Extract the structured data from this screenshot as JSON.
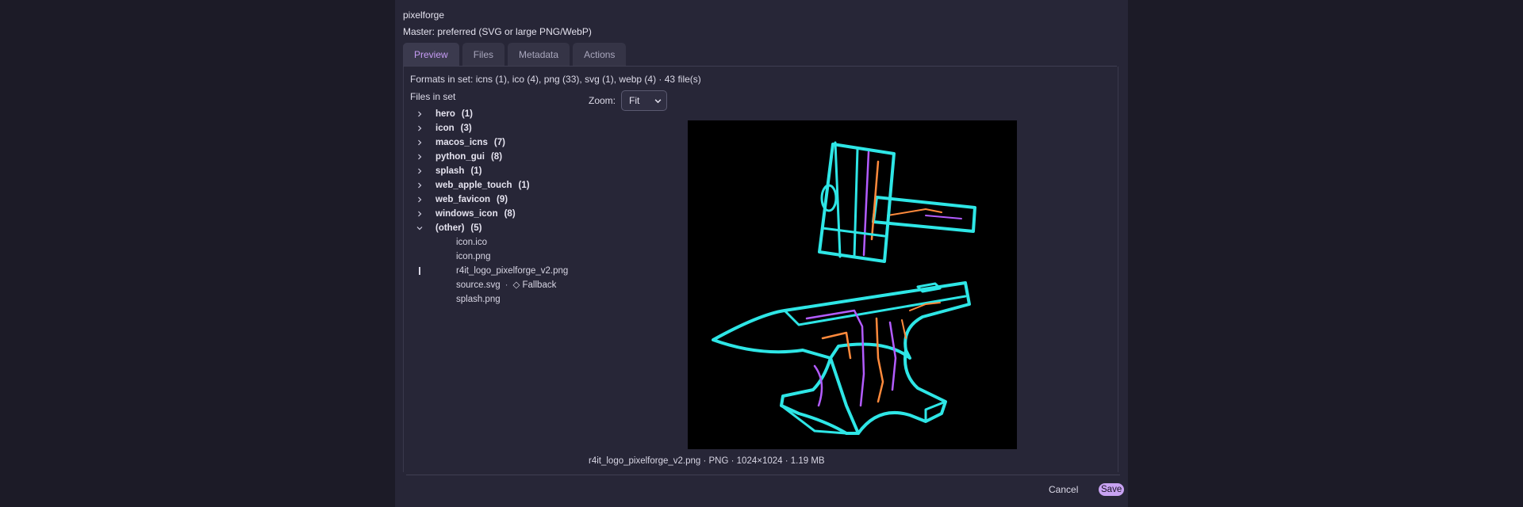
{
  "app_name": "pixelforge",
  "master_note": "Master: preferred (SVG or large PNG/WebP)",
  "tabs": [
    {
      "label": "Preview",
      "active": true
    },
    {
      "label": "Files",
      "active": false
    },
    {
      "label": "Metadata",
      "active": false
    },
    {
      "label": "Actions",
      "active": false
    }
  ],
  "formats_summary": "Formats in set: icns (1), ico (4), png (33), svg (1), webp (4) · 43 file(s)",
  "files_label": "Files in set",
  "tree": {
    "groups": [
      {
        "label": "hero",
        "count": "(1)",
        "expanded": false
      },
      {
        "label": "icon",
        "count": "(3)",
        "expanded": false
      },
      {
        "label": "macos_icns",
        "count": "(7)",
        "expanded": false
      },
      {
        "label": "python_gui",
        "count": "(8)",
        "expanded": false
      },
      {
        "label": "splash",
        "count": "(1)",
        "expanded": false
      },
      {
        "label": "web_apple_touch",
        "count": "(1)",
        "expanded": false
      },
      {
        "label": "web_favicon",
        "count": "(9)",
        "expanded": false
      },
      {
        "label": "windows_icon",
        "count": "(8)",
        "expanded": false
      },
      {
        "label": "(other)",
        "count": "(5)",
        "expanded": true
      }
    ],
    "other_files": [
      {
        "name": "icon.ico"
      },
      {
        "name": "icon.png"
      },
      {
        "name": "r4it_logo_pixelforge_v2.png",
        "selected": true
      },
      {
        "name": "source.svg",
        "separator": "·",
        "tag_icon": "◇",
        "tag": "Fallback"
      },
      {
        "name": "splash.png"
      }
    ]
  },
  "zoom": {
    "label": "Zoom:",
    "value": "Fit"
  },
  "preview_caption": "r4it_logo_pixelforge_v2.png · PNG · 1024×1024 · 1.19 MB",
  "footer": {
    "cancel_label": "Cancel",
    "save_label": "Save"
  },
  "colors": {
    "accent": "#c79cf5",
    "neon_cyan": "#2ee6e6",
    "neon_purple": "#b35cff",
    "neon_orange": "#ff8a3c"
  },
  "icons": {
    "collapsed_chevron": "chevron-right-icon",
    "expanded_chevron": "chevron-down-icon",
    "fallback_tag": "diamond-icon",
    "zoom_dropdown": "chevron-down-icon"
  }
}
